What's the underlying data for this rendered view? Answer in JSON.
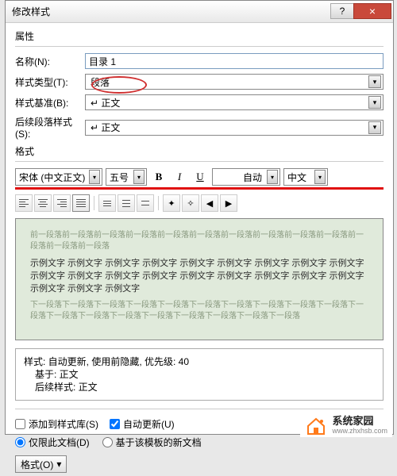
{
  "titlebar": {
    "title": "修改样式",
    "help": "?",
    "close": "×"
  },
  "properties": {
    "section": "属性",
    "name_label": "名称(N):",
    "name_value": "目录 1",
    "type_label": "样式类型(T):",
    "type_value": "段落",
    "base_label": "样式基准(B):",
    "base_value": "↵ 正文",
    "follow_label": "后续段落样式(S):",
    "follow_value": "↵ 正文"
  },
  "format": {
    "section": "格式",
    "font": "宋体 (中文正文)",
    "size": "五号",
    "color": "自动",
    "lang": "中文",
    "bold": "B",
    "italic": "I",
    "underline": "U"
  },
  "preview": {
    "ghost_before": "前一段落前一段落前一段落前一段落前一段落前一段落前一段落前一段落前一段落前一段落前一段落前一段落前一段落",
    "sample_line": "示例文字 示例文字 示例文字 示例文字 示例文字 示例文字 示例文字 示例文字 示例文字 示例文字 示例文字 示例文字 示例文字 示例文字 示例文字 示例文字 示例文字 示例文字 示例文字 示例文字 示例文字",
    "ghost_after": "下一段落下一段落下一段落下一段落下一段落下一段落下一段落下一段落下一段落下一段落下一段落下一段落下一段落下一段落下一段落下一段落下一段落下一段落下一段落"
  },
  "desc": {
    "line1": "样式: 自动更新, 使用前隐藏, 优先级: 40",
    "line2": "基于: 正文",
    "line3": "后续样式: 正文"
  },
  "options": {
    "add_library": "添加到样式库(S)",
    "auto_update": "自动更新(U)",
    "only_doc": "仅限此文档(D)",
    "based_template": "基于该模板的新文档"
  },
  "footer": {
    "format_btn": "格式(O)"
  },
  "watermark": {
    "cn": "系统家园",
    "url": "www.zhxhsb.com"
  },
  "arrow": "▾"
}
